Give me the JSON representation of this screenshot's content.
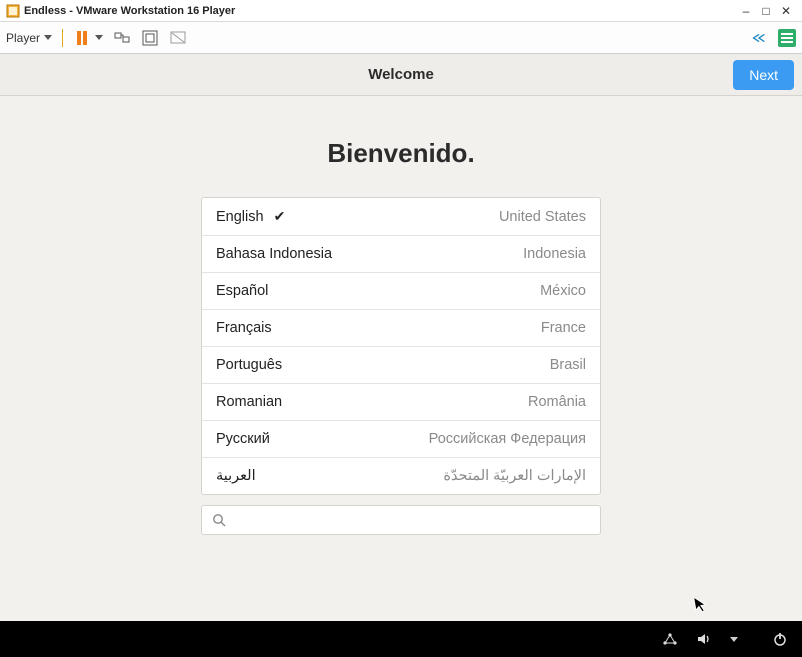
{
  "window": {
    "title": "Endless - VMware Workstation 16 Player"
  },
  "toolbar": {
    "player_menu_label": "Player"
  },
  "header": {
    "title": "Welcome",
    "next_label": "Next"
  },
  "content": {
    "heading": "Bienvenido."
  },
  "languages": [
    {
      "name": "English",
      "country": "United States",
      "selected": true
    },
    {
      "name": "Bahasa Indonesia",
      "country": "Indonesia",
      "selected": false
    },
    {
      "name": "Español",
      "country": "México",
      "selected": false
    },
    {
      "name": "Français",
      "country": "France",
      "selected": false
    },
    {
      "name": "Português",
      "country": "Brasil",
      "selected": false
    },
    {
      "name": "Romanian",
      "country": "România",
      "selected": false
    },
    {
      "name": "Русский",
      "country": "Российская Федерация",
      "selected": false
    },
    {
      "name": "العربية",
      "country": "الإمارات العربيّة المتحدّة",
      "selected": false
    }
  ],
  "search": {
    "placeholder": ""
  }
}
